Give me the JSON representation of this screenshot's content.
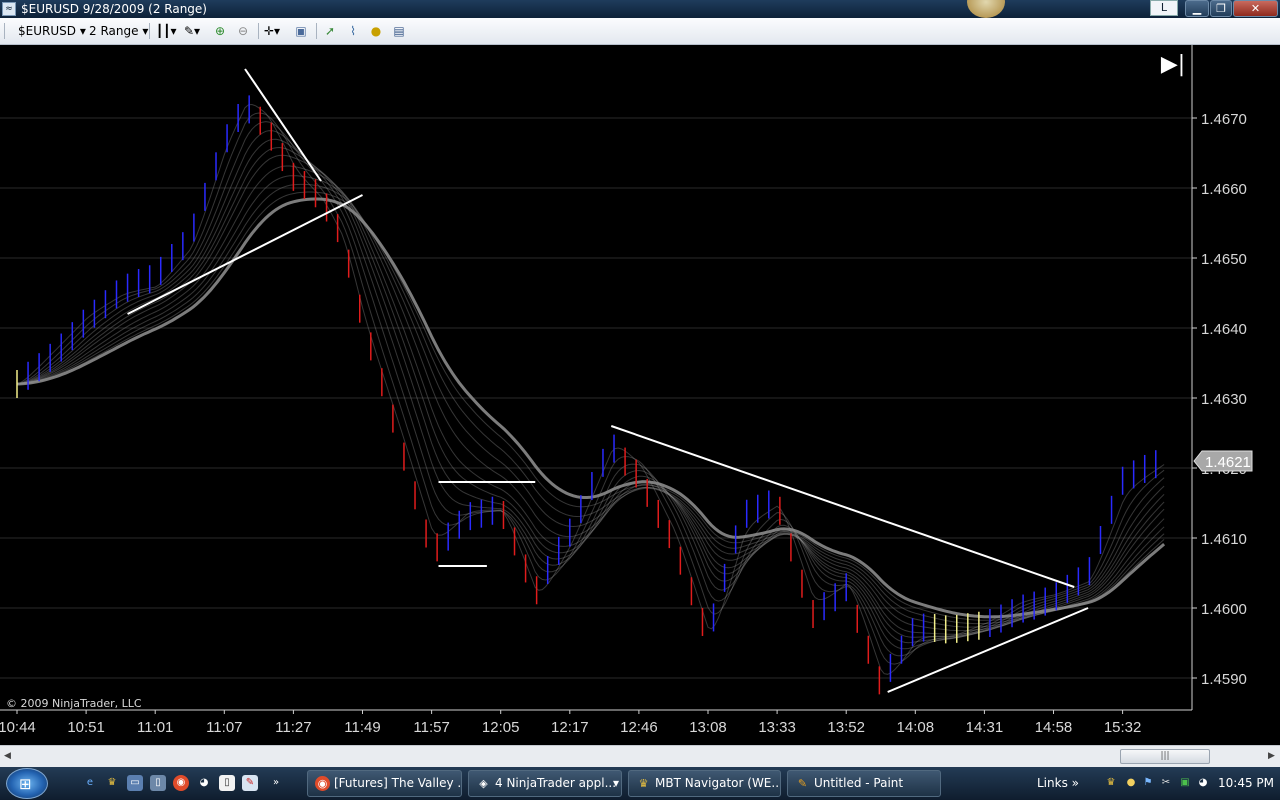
{
  "window": {
    "title": "$EURUSD  9/28/2009 (2 Range)",
    "lang_indicator": "L",
    "buttons": {
      "minimize": "▁",
      "maximize": "❐",
      "close": "✕"
    }
  },
  "toolbar": {
    "instrument": "$EURUSD",
    "period": "2 Range",
    "icons": [
      "bar-style-icon",
      "draw-tools-icon",
      "zoom-in-icon",
      "zoom-out-icon",
      "crosshair-icon",
      "properties-icon",
      "strategy-icon",
      "indicators-icon",
      "coin-icon",
      "data-box-icon"
    ]
  },
  "chart": {
    "go_to_end_icon": "skip-to-end-icon",
    "copyright": "© 2009 NinjaTrader, LLC",
    "price_marker": "1.4621",
    "colors": {
      "up_bar": "#2a2aff",
      "down_bar": "#e01c1c",
      "neutral_bar": "#f2ef8a",
      "trendline": "#ffffff",
      "ribbon": "#9a9a9a"
    }
  },
  "chart_data": {
    "type": "line",
    "title": "",
    "xlabel": "",
    "ylabel": "",
    "ylim": [
      1.4583,
      1.469
    ],
    "yticks": [
      "1.4670",
      "1.4660",
      "1.4650",
      "1.4640",
      "1.4630",
      "1.4620",
      "1.4610",
      "1.4600",
      "1.4590"
    ],
    "x_labels": [
      "10:44",
      "10:51",
      "11:01",
      "11:07",
      "11:27",
      "11:49",
      "11:57",
      "12:05",
      "12:17",
      "12:46",
      "13:08",
      "13:33",
      "13:52",
      "14:08",
      "14:31",
      "14:58",
      "15:32"
    ],
    "series": [
      {
        "points": [
          [
            0,
            1.4632
          ],
          [
            1,
            1.4642
          ],
          [
            1.5,
            1.4645
          ],
          [
            2,
            1.4646
          ],
          [
            2.5,
            1.4652
          ],
          [
            3,
            1.4667
          ],
          [
            3.3,
            1.4673
          ],
          [
            3.6,
            1.467
          ],
          [
            4,
            1.4662
          ],
          [
            4.4,
            1.4658
          ],
          [
            4.7,
            1.4652
          ],
          [
            5,
            1.464
          ],
          [
            5.5,
            1.4625
          ],
          [
            6,
            1.4609
          ],
          [
            6.5,
            1.4614
          ],
          [
            7,
            1.4614
          ],
          [
            7.5,
            1.4601
          ],
          [
            8,
            1.461
          ],
          [
            8.6,
            1.4624
          ],
          [
            9,
            1.462
          ],
          [
            9.5,
            1.461
          ],
          [
            10,
            1.4595
          ],
          [
            10.5,
            1.4612
          ],
          [
            11,
            1.4615
          ],
          [
            11.5,
            1.46
          ],
          [
            12,
            1.4604
          ],
          [
            12.5,
            1.4589
          ],
          [
            13,
            1.4596
          ],
          [
            13.5,
            1.4596
          ],
          [
            14,
            1.4598
          ],
          [
            14.5,
            1.4601
          ],
          [
            15,
            1.4602
          ],
          [
            15.5,
            1.4604
          ],
          [
            16,
            1.4617
          ],
          [
            16.6,
            1.4621
          ]
        ]
      }
    ],
    "trendlines": [
      {
        "from": [
          3.3,
          1.4677
        ],
        "to": [
          4.4,
          1.4661
        ]
      },
      {
        "from": [
          1.6,
          1.4642
        ],
        "to": [
          5.0,
          1.4659
        ]
      },
      {
        "from": [
          6.1,
          1.4618
        ],
        "to": [
          7.5,
          1.4618
        ]
      },
      {
        "from": [
          6.1,
          1.4606
        ],
        "to": [
          6.8,
          1.4606
        ]
      },
      {
        "from": [
          8.6,
          1.4626
        ],
        "to": [
          15.3,
          1.4603
        ]
      },
      {
        "from": [
          12.6,
          1.4588
        ],
        "to": [
          15.5,
          1.46
        ]
      }
    ],
    "grid": true,
    "current_price": 1.4621
  },
  "scrollbar": {
    "left_arrow": "◀",
    "right_arrow": "▶",
    "grip": "|||"
  },
  "taskbar": {
    "tasks": [
      {
        "label": "[Futures] The Valley ...",
        "icon": "chrome-icon"
      },
      {
        "label": "4  NinjaTrader appl...",
        "icon": "ninjatrader-icon"
      },
      {
        "label": "MBT Navigator (WE...",
        "icon": "mbt-icon"
      },
      {
        "label": "Untitled - Paint",
        "icon": "paint-icon"
      }
    ],
    "links": "Links",
    "more": "»",
    "clock": "10:45 PM"
  }
}
